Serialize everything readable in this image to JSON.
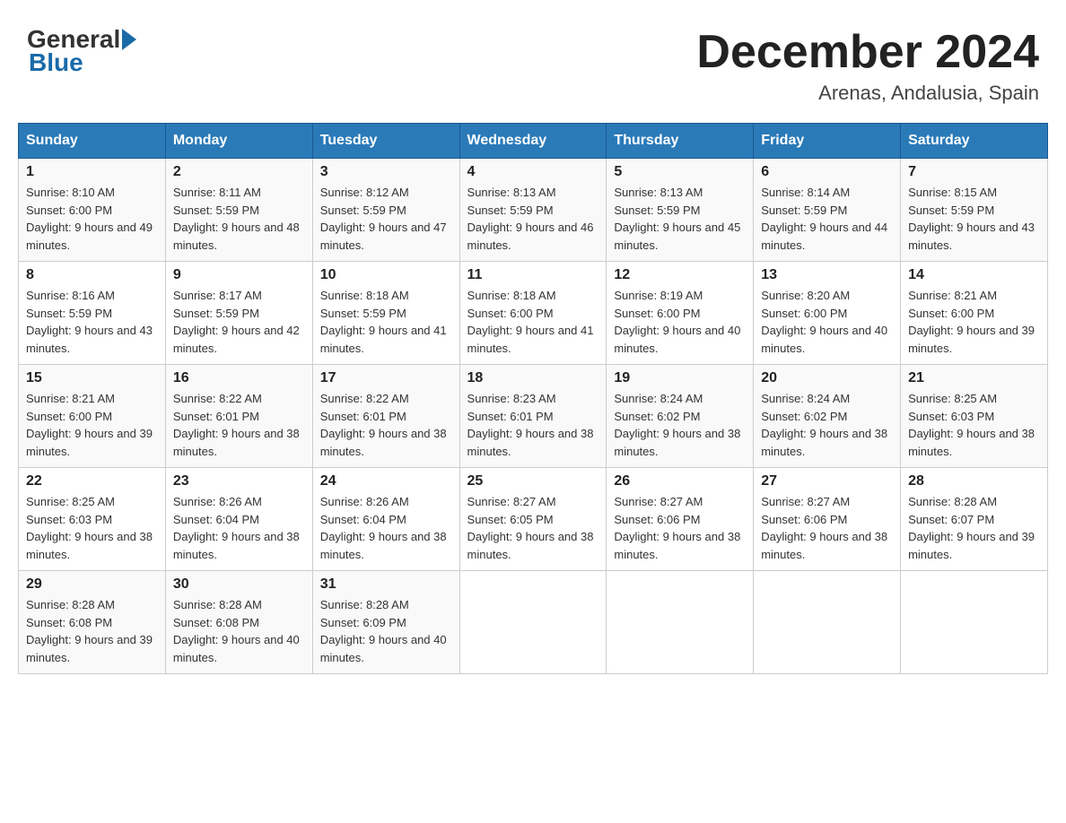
{
  "header": {
    "month_title": "December 2024",
    "location": "Arenas, Andalusia, Spain",
    "logo_general": "General",
    "logo_blue": "Blue"
  },
  "days_of_week": [
    "Sunday",
    "Monday",
    "Tuesday",
    "Wednesday",
    "Thursday",
    "Friday",
    "Saturday"
  ],
  "weeks": [
    [
      {
        "day": "1",
        "sunrise": "Sunrise: 8:10 AM",
        "sunset": "Sunset: 6:00 PM",
        "daylight": "Daylight: 9 hours and 49 minutes."
      },
      {
        "day": "2",
        "sunrise": "Sunrise: 8:11 AM",
        "sunset": "Sunset: 5:59 PM",
        "daylight": "Daylight: 9 hours and 48 minutes."
      },
      {
        "day": "3",
        "sunrise": "Sunrise: 8:12 AM",
        "sunset": "Sunset: 5:59 PM",
        "daylight": "Daylight: 9 hours and 47 minutes."
      },
      {
        "day": "4",
        "sunrise": "Sunrise: 8:13 AM",
        "sunset": "Sunset: 5:59 PM",
        "daylight": "Daylight: 9 hours and 46 minutes."
      },
      {
        "day": "5",
        "sunrise": "Sunrise: 8:13 AM",
        "sunset": "Sunset: 5:59 PM",
        "daylight": "Daylight: 9 hours and 45 minutes."
      },
      {
        "day": "6",
        "sunrise": "Sunrise: 8:14 AM",
        "sunset": "Sunset: 5:59 PM",
        "daylight": "Daylight: 9 hours and 44 minutes."
      },
      {
        "day": "7",
        "sunrise": "Sunrise: 8:15 AM",
        "sunset": "Sunset: 5:59 PM",
        "daylight": "Daylight: 9 hours and 43 minutes."
      }
    ],
    [
      {
        "day": "8",
        "sunrise": "Sunrise: 8:16 AM",
        "sunset": "Sunset: 5:59 PM",
        "daylight": "Daylight: 9 hours and 43 minutes."
      },
      {
        "day": "9",
        "sunrise": "Sunrise: 8:17 AM",
        "sunset": "Sunset: 5:59 PM",
        "daylight": "Daylight: 9 hours and 42 minutes."
      },
      {
        "day": "10",
        "sunrise": "Sunrise: 8:18 AM",
        "sunset": "Sunset: 5:59 PM",
        "daylight": "Daylight: 9 hours and 41 minutes."
      },
      {
        "day": "11",
        "sunrise": "Sunrise: 8:18 AM",
        "sunset": "Sunset: 6:00 PM",
        "daylight": "Daylight: 9 hours and 41 minutes."
      },
      {
        "day": "12",
        "sunrise": "Sunrise: 8:19 AM",
        "sunset": "Sunset: 6:00 PM",
        "daylight": "Daylight: 9 hours and 40 minutes."
      },
      {
        "day": "13",
        "sunrise": "Sunrise: 8:20 AM",
        "sunset": "Sunset: 6:00 PM",
        "daylight": "Daylight: 9 hours and 40 minutes."
      },
      {
        "day": "14",
        "sunrise": "Sunrise: 8:21 AM",
        "sunset": "Sunset: 6:00 PM",
        "daylight": "Daylight: 9 hours and 39 minutes."
      }
    ],
    [
      {
        "day": "15",
        "sunrise": "Sunrise: 8:21 AM",
        "sunset": "Sunset: 6:00 PM",
        "daylight": "Daylight: 9 hours and 39 minutes."
      },
      {
        "day": "16",
        "sunrise": "Sunrise: 8:22 AM",
        "sunset": "Sunset: 6:01 PM",
        "daylight": "Daylight: 9 hours and 38 minutes."
      },
      {
        "day": "17",
        "sunrise": "Sunrise: 8:22 AM",
        "sunset": "Sunset: 6:01 PM",
        "daylight": "Daylight: 9 hours and 38 minutes."
      },
      {
        "day": "18",
        "sunrise": "Sunrise: 8:23 AM",
        "sunset": "Sunset: 6:01 PM",
        "daylight": "Daylight: 9 hours and 38 minutes."
      },
      {
        "day": "19",
        "sunrise": "Sunrise: 8:24 AM",
        "sunset": "Sunset: 6:02 PM",
        "daylight": "Daylight: 9 hours and 38 minutes."
      },
      {
        "day": "20",
        "sunrise": "Sunrise: 8:24 AM",
        "sunset": "Sunset: 6:02 PM",
        "daylight": "Daylight: 9 hours and 38 minutes."
      },
      {
        "day": "21",
        "sunrise": "Sunrise: 8:25 AM",
        "sunset": "Sunset: 6:03 PM",
        "daylight": "Daylight: 9 hours and 38 minutes."
      }
    ],
    [
      {
        "day": "22",
        "sunrise": "Sunrise: 8:25 AM",
        "sunset": "Sunset: 6:03 PM",
        "daylight": "Daylight: 9 hours and 38 minutes."
      },
      {
        "day": "23",
        "sunrise": "Sunrise: 8:26 AM",
        "sunset": "Sunset: 6:04 PM",
        "daylight": "Daylight: 9 hours and 38 minutes."
      },
      {
        "day": "24",
        "sunrise": "Sunrise: 8:26 AM",
        "sunset": "Sunset: 6:04 PM",
        "daylight": "Daylight: 9 hours and 38 minutes."
      },
      {
        "day": "25",
        "sunrise": "Sunrise: 8:27 AM",
        "sunset": "Sunset: 6:05 PM",
        "daylight": "Daylight: 9 hours and 38 minutes."
      },
      {
        "day": "26",
        "sunrise": "Sunrise: 8:27 AM",
        "sunset": "Sunset: 6:06 PM",
        "daylight": "Daylight: 9 hours and 38 minutes."
      },
      {
        "day": "27",
        "sunrise": "Sunrise: 8:27 AM",
        "sunset": "Sunset: 6:06 PM",
        "daylight": "Daylight: 9 hours and 38 minutes."
      },
      {
        "day": "28",
        "sunrise": "Sunrise: 8:28 AM",
        "sunset": "Sunset: 6:07 PM",
        "daylight": "Daylight: 9 hours and 39 minutes."
      }
    ],
    [
      {
        "day": "29",
        "sunrise": "Sunrise: 8:28 AM",
        "sunset": "Sunset: 6:08 PM",
        "daylight": "Daylight: 9 hours and 39 minutes."
      },
      {
        "day": "30",
        "sunrise": "Sunrise: 8:28 AM",
        "sunset": "Sunset: 6:08 PM",
        "daylight": "Daylight: 9 hours and 40 minutes."
      },
      {
        "day": "31",
        "sunrise": "Sunrise: 8:28 AM",
        "sunset": "Sunset: 6:09 PM",
        "daylight": "Daylight: 9 hours and 40 minutes."
      },
      null,
      null,
      null,
      null
    ]
  ]
}
